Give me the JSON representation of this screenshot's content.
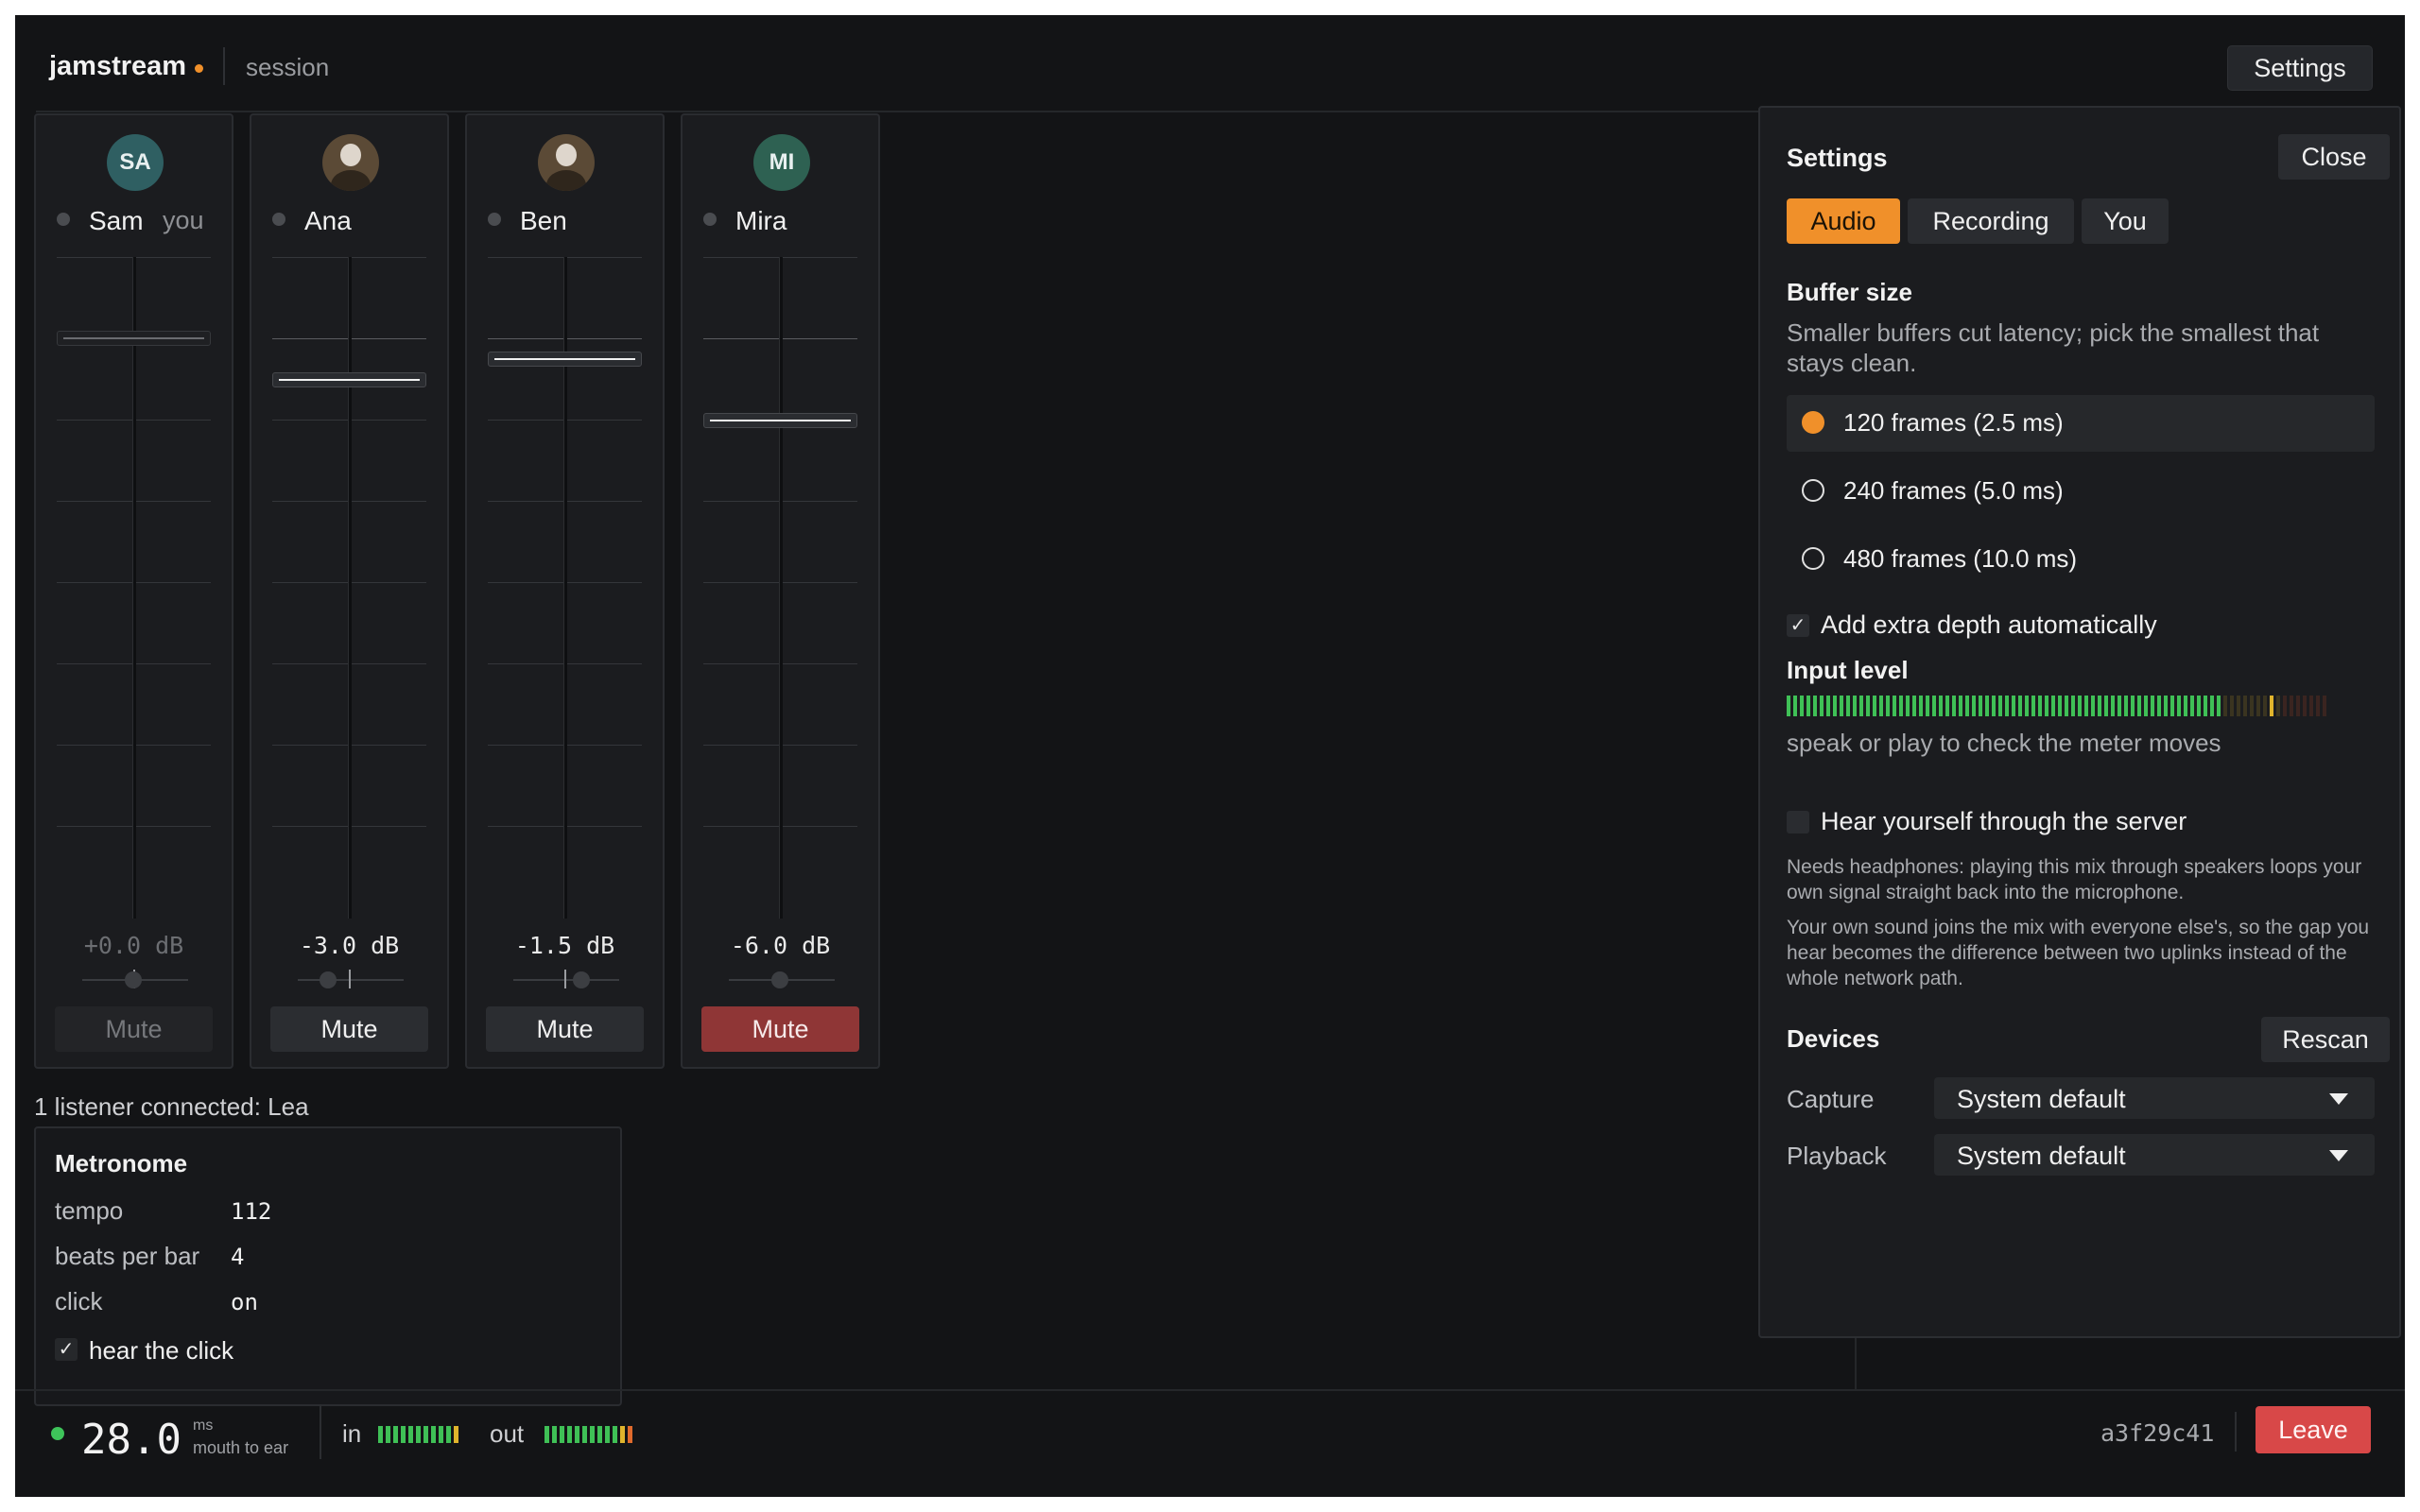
{
  "header": {
    "brand": "jamstream",
    "section": "session",
    "settings_label": "Settings"
  },
  "channels": [
    {
      "initials": "SA",
      "name": "Sam",
      "tag": "you",
      "avatar_type": "initials",
      "gain_db": 0.0,
      "gain_label": "+0.0 dB",
      "mute_label": "Mute",
      "muted": false,
      "is_self": true
    },
    {
      "initials": "",
      "name": "Ana",
      "tag": "",
      "avatar_type": "photo",
      "gain_db": -3.0,
      "gain_label": "-3.0 dB",
      "mute_label": "Mute",
      "muted": false,
      "is_self": false
    },
    {
      "initials": "",
      "name": "Ben",
      "tag": "",
      "avatar_type": "photo",
      "gain_db": -1.5,
      "gain_label": "-1.5 dB",
      "mute_label": "Mute",
      "muted": false,
      "is_self": false
    },
    {
      "initials": "MI",
      "name": "Mira",
      "tag": "",
      "avatar_type": "initials",
      "gain_db": -6.0,
      "gain_label": "-6.0 dB",
      "mute_label": "Mute",
      "muted": true,
      "is_self": false
    }
  ],
  "listeners_text": "1 listener connected: Lea",
  "metronome": {
    "title": "Metronome",
    "rows": [
      {
        "key": "tempo",
        "value": "112"
      },
      {
        "key": "beats per bar",
        "value": "4"
      },
      {
        "key": "click",
        "value": "on"
      }
    ],
    "hear_click_label": "hear the click",
    "hear_click_checked": true
  },
  "footer": {
    "latency_value": "28.0",
    "latency_unit": "ms",
    "latency_caption": "mouth to ear",
    "in_label": "in",
    "out_label": "out",
    "session_id": "a3f29c41",
    "leave_label": "Leave"
  },
  "settings_panel": {
    "title": "Settings",
    "close_label": "Close",
    "tabs": [
      {
        "label": "Audio",
        "active": true
      },
      {
        "label": "Recording",
        "active": false
      },
      {
        "label": "You",
        "active": false
      }
    ],
    "buffer": {
      "title": "Buffer size",
      "help": "Smaller buffers cut latency; pick the smallest that stays clean.",
      "options": [
        {
          "label": "120 frames (2.5 ms)",
          "selected": true
        },
        {
          "label": "240 frames (5.0 ms)",
          "selected": false
        },
        {
          "label": "480 frames (10.0 ms)",
          "selected": false
        }
      ],
      "extra_depth_label": "Add extra depth automatically",
      "extra_depth_checked": true
    },
    "input_level": {
      "title": "Input level",
      "level_fraction": 0.8,
      "help": "speak or play to check the meter moves"
    },
    "monitor": {
      "label": "Hear yourself through the server",
      "checked": false,
      "note1": "Needs headphones: playing this mix through speakers loops your own signal straight back into the microphone.",
      "note2": "Your own sound joins the mix with everyone else's, so the gap you hear becomes the difference between two uplinks instead of the whole network path."
    },
    "devices": {
      "title": "Devices",
      "rescan_label": "Rescan",
      "capture_label": "Capture",
      "capture_value": "System default",
      "playback_label": "Playback",
      "playback_value": "System default"
    }
  },
  "colors": {
    "accent": "#f0902a",
    "mute_active": "#8f3636",
    "leave": "#d84848",
    "meter_green": "#3fc056"
  }
}
